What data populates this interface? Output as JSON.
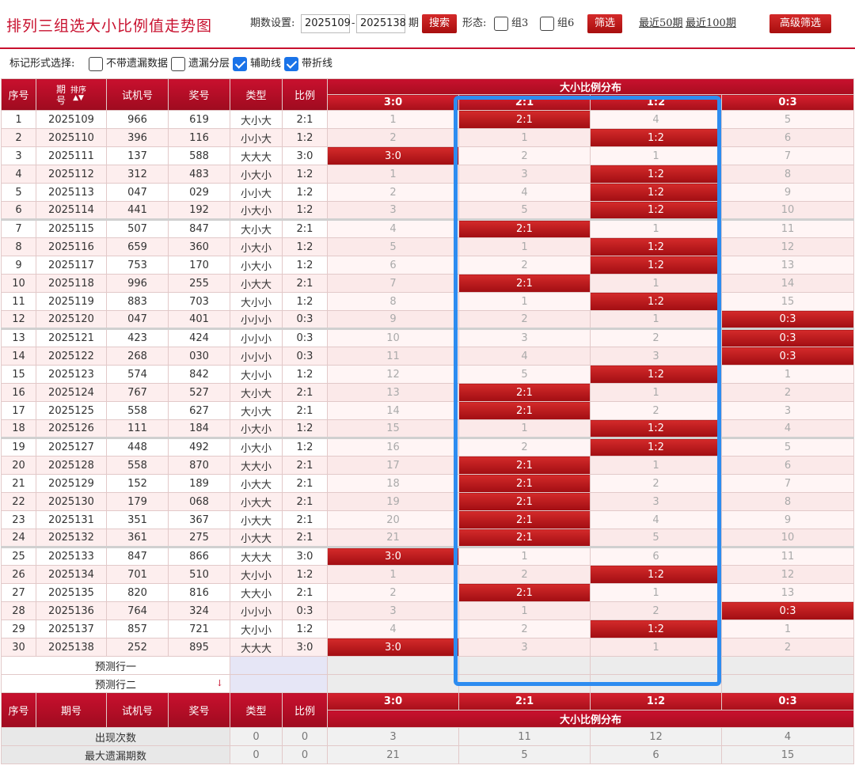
{
  "header": {
    "title": "排列三组选大小比例值走势图",
    "period_label": "期数设置:",
    "period_from": "2025109",
    "period_to": "2025138",
    "dash": "-",
    "period_unit": "期",
    "search_label": "搜索",
    "form_label": "形态:",
    "group3_label": "组3",
    "group6_label": "组6",
    "filter_label": "筛选",
    "recent50": "最近50期",
    "recent100": "最近100期",
    "advanced_label": "高级筛选"
  },
  "markbar": {
    "label": "标记形式选择:",
    "options": [
      {
        "label": "不带遗漏数据",
        "checked": false
      },
      {
        "label": "遗漏分层",
        "checked": false
      },
      {
        "label": "辅助线",
        "checked": true
      },
      {
        "label": "带折线",
        "checked": true
      }
    ]
  },
  "columns": {
    "idx": "序号",
    "issue_a": "期",
    "issue_b": "号",
    "sort_label": "排序",
    "sort_arrows": "▲▼",
    "trial": "试机号",
    "draw": "奖号",
    "type": "类型",
    "ratio": "比例",
    "dist_title": "大小比例分布",
    "dist": [
      "3:0",
      "2:1",
      "1:2",
      "0:3"
    ]
  },
  "rows": [
    {
      "idx": "1",
      "issue": "2025109",
      "trial": "966",
      "draw": "619",
      "type": "大小大",
      "ratio": "2:1",
      "dist": [
        "1",
        "2:1",
        "4",
        "5"
      ]
    },
    {
      "idx": "2",
      "issue": "2025110",
      "trial": "396",
      "draw": "116",
      "type": "小小大",
      "ratio": "1:2",
      "dist": [
        "2",
        "1",
        "1:2",
        "6"
      ]
    },
    {
      "idx": "3",
      "issue": "2025111",
      "trial": "137",
      "draw": "588",
      "type": "大大大",
      "ratio": "3:0",
      "dist": [
        "3:0",
        "2",
        "1",
        "7"
      ]
    },
    {
      "idx": "4",
      "issue": "2025112",
      "trial": "312",
      "draw": "483",
      "type": "小大小",
      "ratio": "1:2",
      "dist": [
        "1",
        "3",
        "1:2",
        "8"
      ]
    },
    {
      "idx": "5",
      "issue": "2025113",
      "trial": "047",
      "draw": "029",
      "type": "小小大",
      "ratio": "1:2",
      "dist": [
        "2",
        "4",
        "1:2",
        "9"
      ]
    },
    {
      "idx": "6",
      "issue": "2025114",
      "trial": "441",
      "draw": "192",
      "type": "小大小",
      "ratio": "1:2",
      "dist": [
        "3",
        "5",
        "1:2",
        "10"
      ]
    },
    {
      "idx": "7",
      "issue": "2025115",
      "trial": "507",
      "draw": "847",
      "type": "大小大",
      "ratio": "2:1",
      "dist": [
        "4",
        "2:1",
        "1",
        "11"
      ]
    },
    {
      "idx": "8",
      "issue": "2025116",
      "trial": "659",
      "draw": "360",
      "type": "小大小",
      "ratio": "1:2",
      "dist": [
        "5",
        "1",
        "1:2",
        "12"
      ]
    },
    {
      "idx": "9",
      "issue": "2025117",
      "trial": "753",
      "draw": "170",
      "type": "小大小",
      "ratio": "1:2",
      "dist": [
        "6",
        "2",
        "1:2",
        "13"
      ]
    },
    {
      "idx": "10",
      "issue": "2025118",
      "trial": "996",
      "draw": "255",
      "type": "小大大",
      "ratio": "2:1",
      "dist": [
        "7",
        "2:1",
        "1",
        "14"
      ]
    },
    {
      "idx": "11",
      "issue": "2025119",
      "trial": "883",
      "draw": "703",
      "type": "大小小",
      "ratio": "1:2",
      "dist": [
        "8",
        "1",
        "1:2",
        "15"
      ]
    },
    {
      "idx": "12",
      "issue": "2025120",
      "trial": "047",
      "draw": "401",
      "type": "小小小",
      "ratio": "0:3",
      "dist": [
        "9",
        "2",
        "1",
        "0:3"
      ]
    },
    {
      "idx": "13",
      "issue": "2025121",
      "trial": "423",
      "draw": "424",
      "type": "小小小",
      "ratio": "0:3",
      "dist": [
        "10",
        "3",
        "2",
        "0:3"
      ]
    },
    {
      "idx": "14",
      "issue": "2025122",
      "trial": "268",
      "draw": "030",
      "type": "小小小",
      "ratio": "0:3",
      "dist": [
        "11",
        "4",
        "3",
        "0:3"
      ]
    },
    {
      "idx": "15",
      "issue": "2025123",
      "trial": "574",
      "draw": "842",
      "type": "大小小",
      "ratio": "1:2",
      "dist": [
        "12",
        "5",
        "1:2",
        "1"
      ]
    },
    {
      "idx": "16",
      "issue": "2025124",
      "trial": "767",
      "draw": "527",
      "type": "大小大",
      "ratio": "2:1",
      "dist": [
        "13",
        "2:1",
        "1",
        "2"
      ]
    },
    {
      "idx": "17",
      "issue": "2025125",
      "trial": "558",
      "draw": "627",
      "type": "大小大",
      "ratio": "2:1",
      "dist": [
        "14",
        "2:1",
        "2",
        "3"
      ]
    },
    {
      "idx": "18",
      "issue": "2025126",
      "trial": "111",
      "draw": "184",
      "type": "小大小",
      "ratio": "1:2",
      "dist": [
        "15",
        "1",
        "1:2",
        "4"
      ]
    },
    {
      "idx": "19",
      "issue": "2025127",
      "trial": "448",
      "draw": "492",
      "type": "小大小",
      "ratio": "1:2",
      "dist": [
        "16",
        "2",
        "1:2",
        "5"
      ]
    },
    {
      "idx": "20",
      "issue": "2025128",
      "trial": "558",
      "draw": "870",
      "type": "大大小",
      "ratio": "2:1",
      "dist": [
        "17",
        "2:1",
        "1",
        "6"
      ]
    },
    {
      "idx": "21",
      "issue": "2025129",
      "trial": "152",
      "draw": "189",
      "type": "小大大",
      "ratio": "2:1",
      "dist": [
        "18",
        "2:1",
        "2",
        "7"
      ]
    },
    {
      "idx": "22",
      "issue": "2025130",
      "trial": "179",
      "draw": "068",
      "type": "小大大",
      "ratio": "2:1",
      "dist": [
        "19",
        "2:1",
        "3",
        "8"
      ]
    },
    {
      "idx": "23",
      "issue": "2025131",
      "trial": "351",
      "draw": "367",
      "type": "小大大",
      "ratio": "2:1",
      "dist": [
        "20",
        "2:1",
        "4",
        "9"
      ]
    },
    {
      "idx": "24",
      "issue": "2025132",
      "trial": "361",
      "draw": "275",
      "type": "小大大",
      "ratio": "2:1",
      "dist": [
        "21",
        "2:1",
        "5",
        "10"
      ]
    },
    {
      "idx": "25",
      "issue": "2025133",
      "trial": "847",
      "draw": "866",
      "type": "大大大",
      "ratio": "3:0",
      "dist": [
        "3:0",
        "1",
        "6",
        "11"
      ]
    },
    {
      "idx": "26",
      "issue": "2025134",
      "trial": "701",
      "draw": "510",
      "type": "大小小",
      "ratio": "1:2",
      "dist": [
        "1",
        "2",
        "1:2",
        "12"
      ]
    },
    {
      "idx": "27",
      "issue": "2025135",
      "trial": "820",
      "draw": "816",
      "type": "大大小",
      "ratio": "2:1",
      "dist": [
        "2",
        "2:1",
        "1",
        "13"
      ]
    },
    {
      "idx": "28",
      "issue": "2025136",
      "trial": "764",
      "draw": "324",
      "type": "小小小",
      "ratio": "0:3",
      "dist": [
        "3",
        "1",
        "2",
        "0:3"
      ]
    },
    {
      "idx": "29",
      "issue": "2025137",
      "trial": "857",
      "draw": "721",
      "type": "大小小",
      "ratio": "1:2",
      "dist": [
        "4",
        "2",
        "1:2",
        "1"
      ]
    },
    {
      "idx": "30",
      "issue": "2025138",
      "trial": "252",
      "draw": "895",
      "type": "大大大",
      "ratio": "3:0",
      "dist": [
        "3:0",
        "3",
        "1",
        "2"
      ]
    }
  ],
  "predict": {
    "row1": "预测行一",
    "row2": "预测行二",
    "arrow": "↓"
  },
  "stats": [
    {
      "label": "出现次数",
      "type": "0",
      "ratio": "0",
      "dist": [
        "3",
        "11",
        "12",
        "4"
      ]
    },
    {
      "label": "最大遗漏期数",
      "type": "0",
      "ratio": "0",
      "dist": [
        "21",
        "5",
        "6",
        "15"
      ]
    }
  ],
  "colors": {
    "accent_red": "#c8102e",
    "highlight_blue": "#2d8cf0",
    "checkbox_blue": "#1a73e8"
  }
}
